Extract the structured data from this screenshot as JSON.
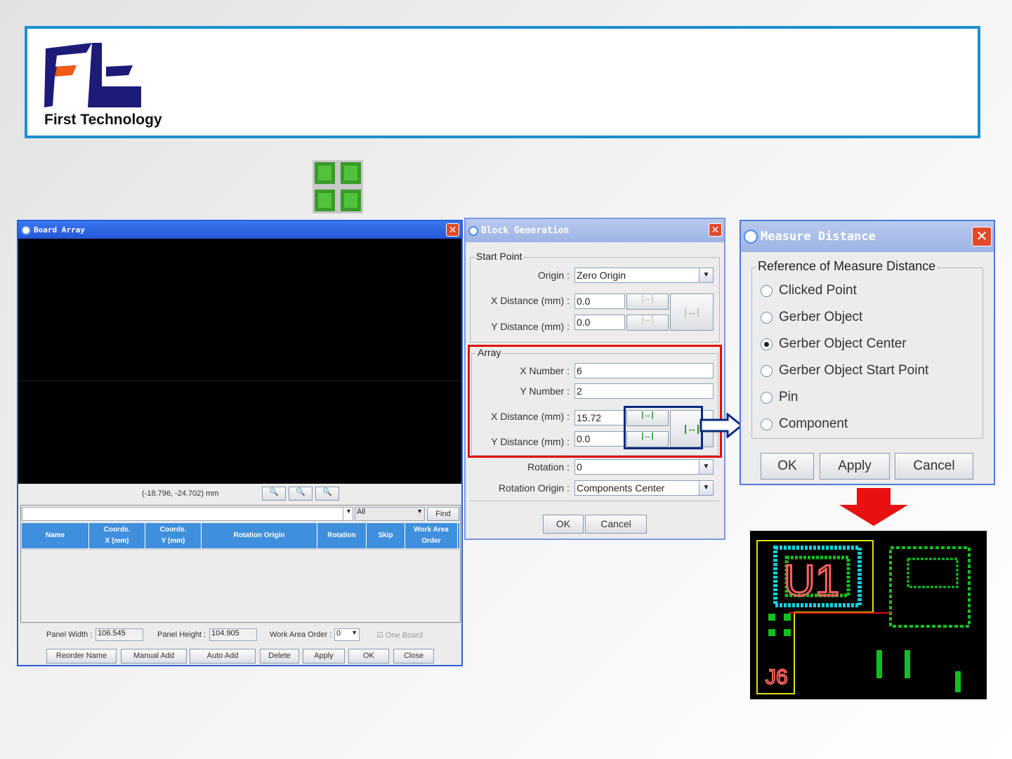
{
  "header": {
    "company": "First Technology"
  },
  "board_array": {
    "title": "Board Array",
    "coords": "(-18.796, -24.702) mm",
    "filter": {
      "value": "",
      "category": "All",
      "find": "Find"
    },
    "columns": [
      {
        "l1": "Name",
        "l2": ""
      },
      {
        "l1": "Coords.",
        "l2": "X (mm)"
      },
      {
        "l1": "Coords.",
        "l2": "Y (mm)"
      },
      {
        "l1": "Rotation Origin",
        "l2": ""
      },
      {
        "l1": "Rotation",
        "l2": ""
      },
      {
        "l1": "Skip",
        "l2": ""
      },
      {
        "l1": "Work Area",
        "l2": "Order"
      }
    ],
    "panel_width_label": "Panel Width :",
    "panel_width": "106.545",
    "panel_height_label": "Panel Height :",
    "panel_height": "104.905",
    "work_area_label": "Work Area Order :",
    "work_area": "0",
    "one_board": "One Board",
    "buttons": [
      "Reorder Name",
      "Manual Add",
      "Auto Add",
      "Delete",
      "Apply",
      "OK",
      "Close"
    ]
  },
  "block_gen": {
    "title": "Block Generation",
    "start_point": "Start Point",
    "origin_label": "Origin :",
    "origin": "Zero Origin",
    "x_dist_label": "X Distance (mm) :",
    "y_dist_label": "Y Distance (mm) :",
    "sp_x": "0.0",
    "sp_y": "0.0",
    "array": "Array",
    "x_num_label": "X Number :",
    "x_num": "6",
    "y_num_label": "Y Number :",
    "y_num": "2",
    "ar_x": "15.72",
    "ar_y": "0.0",
    "rotation_label": "Rotation :",
    "rotation": "0",
    "rot_origin_label": "Rotation Origin :",
    "rot_origin": "Components Center",
    "ok": "OK",
    "cancel": "Cancel"
  },
  "measure": {
    "title": "Measure Distance",
    "group": "Reference of Measure Distance",
    "options": [
      "Clicked Point",
      "Gerber Object",
      "Gerber Object Center",
      "Gerber Object Start Point",
      "Pin",
      "Component"
    ],
    "selected": "Gerber Object Center",
    "ok": "OK",
    "apply": "Apply",
    "cancel": "Cancel"
  },
  "pcb": {
    "label1": "U1",
    "label2": "J6"
  },
  "colors": {
    "highlight": "#e01010",
    "accent": "#1d8fcf",
    "table_header": "#3f8fdc",
    "arrow": "#0a2a80"
  }
}
